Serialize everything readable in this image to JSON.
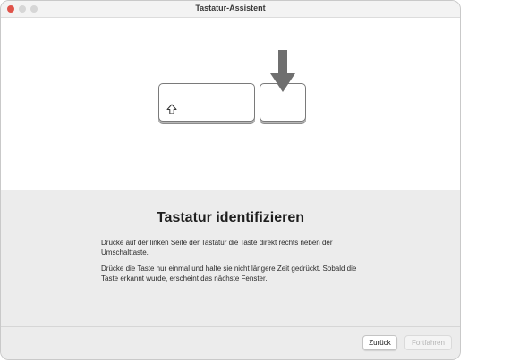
{
  "window": {
    "title": "Tastatur-Assistent"
  },
  "main": {
    "heading": "Tastatur identifizieren",
    "paragraph1": "Drücke auf der linken Seite der Tastatur die Taste direkt rechts neben der Umschalttaste.",
    "paragraph2": "Drücke die Taste nur einmal und halte sie nicht längere Zeit gedrückt. Sobald die Taste erkannt wurde, erscheint das nächste Fenster."
  },
  "footer": {
    "back_label": "Zurück",
    "next_label": "Fortfahren"
  },
  "icons": {
    "shift": "shift-icon",
    "arrow": "down-arrow-icon"
  },
  "colors": {
    "close": "#e0534a",
    "arrow": "#6f6f6f",
    "disabled_text": "#b5b5b5"
  }
}
